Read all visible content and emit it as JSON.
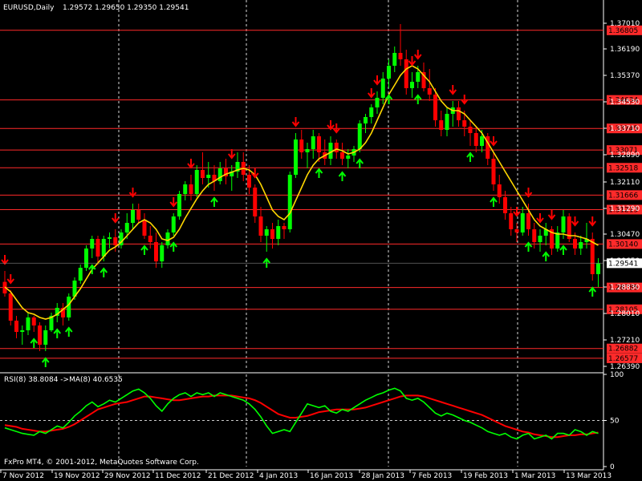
{
  "header": {
    "symbol": "EURUSD,Daily",
    "ohlc": "1.29572 1.29650 1.29350 1.29541"
  },
  "rsi_header": "RSI(8) 38.8084  ->MA(8) 40.6535",
  "footer": "FxPro MT4, © 2001-2012, MetaQuotes Software Corp.",
  "price_axis": {
    "ticks": [
      "1.37010",
      "1.36190",
      "1.35370",
      "1.34530",
      "1.33710",
      "1.32890",
      "1.32110",
      "1.31290",
      "1.30470",
      "1.29650",
      "1.28830",
      "1.28010",
      "1.27210",
      "1.26390"
    ],
    "current": "1.29541",
    "levels": [
      "1.36805",
      "1.34634",
      "1.33745",
      "1.33071",
      "1.32518",
      "1.31666",
      "1.31213",
      "1.30140",
      "1.28785",
      "1.28105",
      "1.26882",
      "1.26577"
    ]
  },
  "rsi_axis": {
    "ticks": [
      "100",
      "50",
      "0"
    ]
  },
  "date_labels": [
    "7 Nov 2012",
    "19 Nov 2012",
    "29 Nov 2012",
    "11 Dec 2012",
    "21 Dec 2012",
    "4 Jan 2013",
    "16 Jan 2013",
    "28 Jan 2013",
    "7 Feb 2013",
    "19 Feb 2013",
    "1 Mar 2013",
    "13 Mar 2013"
  ],
  "colors": {
    "bull": "#00ff00",
    "bear": "#ff0000",
    "ma": "#ffd700",
    "level": "#ff2a2a",
    "rsi": "#00ff00",
    "rsi_ma": "#ff0000",
    "grid": "#ffffff"
  },
  "chart_data": {
    "type": "candlestick",
    "candles": [
      [
        1.2896,
        1.293,
        1.285,
        1.286
      ],
      [
        1.286,
        1.287,
        1.276,
        1.2775
      ],
      [
        1.2775,
        1.279,
        1.272,
        1.274
      ],
      [
        1.274,
        1.276,
        1.27,
        1.2745
      ],
      [
        1.2745,
        1.28,
        1.273,
        1.2785
      ],
      [
        1.2785,
        1.279,
        1.274,
        1.276
      ],
      [
        1.276,
        1.277,
        1.268,
        1.27
      ],
      [
        1.27,
        1.276,
        1.268,
        1.2745
      ],
      [
        1.2745,
        1.28,
        1.274,
        1.279
      ],
      [
        1.279,
        1.283,
        1.277,
        1.2815
      ],
      [
        1.2815,
        1.283,
        1.276,
        1.2785
      ],
      [
        1.2785,
        1.286,
        1.2775,
        1.285
      ],
      [
        1.285,
        1.291,
        1.284,
        1.29
      ],
      [
        1.29,
        1.295,
        1.289,
        1.294
      ],
      [
        1.294,
        1.301,
        1.293,
        1.3
      ],
      [
        1.3,
        1.304,
        1.297,
        1.303
      ],
      [
        1.303,
        1.304,
        1.295,
        1.2975
      ],
      [
        1.2975,
        1.304,
        1.296,
        1.303
      ],
      [
        1.303,
        1.305,
        1.3,
        1.3035
      ],
      [
        1.3035,
        1.306,
        1.299,
        1.301
      ],
      [
        1.301,
        1.306,
        1.3,
        1.305
      ],
      [
        1.305,
        1.311,
        1.303,
        1.308
      ],
      [
        1.308,
        1.314,
        1.306,
        1.312
      ],
      [
        1.312,
        1.314,
        1.308,
        1.309
      ],
      [
        1.309,
        1.311,
        1.303,
        1.304
      ],
      [
        1.304,
        1.307,
        1.3,
        1.302
      ],
      [
        1.302,
        1.305,
        1.294,
        1.296
      ],
      [
        1.296,
        1.302,
        1.294,
        1.301
      ],
      [
        1.301,
        1.306,
        1.3,
        1.305
      ],
      [
        1.305,
        1.311,
        1.304,
        1.31
      ],
      [
        1.31,
        1.318,
        1.309,
        1.317
      ],
      [
        1.317,
        1.321,
        1.315,
        1.32
      ],
      [
        1.32,
        1.323,
        1.315,
        1.317
      ],
      [
        1.317,
        1.326,
        1.316,
        1.3245
      ],
      [
        1.3245,
        1.33,
        1.32,
        1.322
      ],
      [
        1.322,
        1.327,
        1.319,
        1.323
      ],
      [
        1.323,
        1.326,
        1.318,
        1.321
      ],
      [
        1.321,
        1.327,
        1.32,
        1.325
      ],
      [
        1.325,
        1.328,
        1.32,
        1.3225
      ],
      [
        1.3225,
        1.326,
        1.318,
        1.324
      ],
      [
        1.324,
        1.33,
        1.322,
        1.327
      ],
      [
        1.327,
        1.33,
        1.321,
        1.323
      ],
      [
        1.323,
        1.326,
        1.317,
        1.319
      ],
      [
        1.319,
        1.32,
        1.308,
        1.31
      ],
      [
        1.31,
        1.313,
        1.302,
        1.304
      ],
      [
        1.304,
        1.307,
        1.299,
        1.306
      ],
      [
        1.306,
        1.308,
        1.3,
        1.303
      ],
      [
        1.303,
        1.309,
        1.301,
        1.307
      ],
      [
        1.307,
        1.308,
        1.303,
        1.306
      ],
      [
        1.306,
        1.324,
        1.305,
        1.323
      ],
      [
        1.323,
        1.336,
        1.322,
        1.334
      ],
      [
        1.334,
        1.337,
        1.328,
        1.33
      ],
      [
        1.33,
        1.333,
        1.325,
        1.331
      ],
      [
        1.331,
        1.337,
        1.328,
        1.335
      ],
      [
        1.335,
        1.336,
        1.327,
        1.33
      ],
      [
        1.33,
        1.334,
        1.326,
        1.328
      ],
      [
        1.328,
        1.335,
        1.326,
        1.333
      ],
      [
        1.333,
        1.334,
        1.328,
        1.33
      ],
      [
        1.33,
        1.333,
        1.326,
        1.328
      ],
      [
        1.328,
        1.331,
        1.325,
        1.329
      ],
      [
        1.329,
        1.332,
        1.327,
        1.331
      ],
      [
        1.331,
        1.34,
        1.33,
        1.339
      ],
      [
        1.339,
        1.342,
        1.336,
        1.341
      ],
      [
        1.341,
        1.345,
        1.339,
        1.344
      ],
      [
        1.344,
        1.349,
        1.342,
        1.347
      ],
      [
        1.347,
        1.355,
        1.345,
        1.353
      ],
      [
        1.353,
        1.359,
        1.35,
        1.357
      ],
      [
        1.357,
        1.363,
        1.355,
        1.361
      ],
      [
        1.361,
        1.37,
        1.357,
        1.359
      ],
      [
        1.359,
        1.362,
        1.348,
        1.35
      ],
      [
        1.35,
        1.355,
        1.347,
        1.352
      ],
      [
        1.352,
        1.357,
        1.35,
        1.355
      ],
      [
        1.355,
        1.358,
        1.349,
        1.35
      ],
      [
        1.35,
        1.356,
        1.346,
        1.348
      ],
      [
        1.348,
        1.35,
        1.338,
        1.34
      ],
      [
        1.34,
        1.343,
        1.335,
        1.337
      ],
      [
        1.337,
        1.344,
        1.335,
        1.342
      ],
      [
        1.342,
        1.346,
        1.338,
        1.344
      ],
      [
        1.344,
        1.346,
        1.338,
        1.34
      ],
      [
        1.34,
        1.343,
        1.335,
        1.338
      ],
      [
        1.338,
        1.34,
        1.332,
        1.336
      ],
      [
        1.336,
        1.338,
        1.33,
        1.332
      ],
      [
        1.332,
        1.337,
        1.33,
        1.335
      ],
      [
        1.335,
        1.336,
        1.326,
        1.328
      ],
      [
        1.328,
        1.33,
        1.318,
        1.32
      ],
      [
        1.32,
        1.323,
        1.314,
        1.316
      ],
      [
        1.316,
        1.318,
        1.309,
        1.311
      ],
      [
        1.311,
        1.313,
        1.304,
        1.306
      ],
      [
        1.306,
        1.308,
        1.302,
        1.305
      ],
      [
        1.305,
        1.313,
        1.304,
        1.311
      ],
      [
        1.311,
        1.314,
        1.304,
        1.306
      ],
      [
        1.306,
        1.308,
        1.3,
        1.302
      ],
      [
        1.302,
        1.306,
        1.299,
        1.304
      ],
      [
        1.304,
        1.308,
        1.301,
        1.306
      ],
      [
        1.306,
        1.307,
        1.298,
        1.3
      ],
      [
        1.3,
        1.307,
        1.299,
        1.305
      ],
      [
        1.305,
        1.312,
        1.303,
        1.31
      ],
      [
        1.31,
        1.311,
        1.302,
        1.303
      ],
      [
        1.303,
        1.305,
        1.298,
        1.3
      ],
      [
        1.3,
        1.304,
        1.298,
        1.302
      ],
      [
        1.302,
        1.308,
        1.3,
        1.303
      ],
      [
        1.303,
        1.305,
        1.29,
        1.292
      ],
      [
        1.292,
        1.297,
        1.288,
        1.2954
      ]
    ],
    "ma": [
      1.288,
      1.2865,
      1.284,
      1.2815,
      1.28,
      1.2795,
      1.2785,
      1.278,
      1.2785,
      1.2795,
      1.281,
      1.2825,
      1.285,
      1.2875,
      1.2905,
      1.2935,
      1.2955,
      1.2975,
      1.2995,
      1.3005,
      1.302,
      1.304,
      1.306,
      1.308,
      1.309,
      1.308,
      1.306,
      1.303,
      1.3025,
      1.3035,
      1.306,
      1.3095,
      1.3125,
      1.3155,
      1.318,
      1.32,
      1.321,
      1.3222,
      1.3232,
      1.3238,
      1.3245,
      1.325,
      1.3245,
      1.323,
      1.32,
      1.316,
      1.312,
      1.31,
      1.309,
      1.311,
      1.315,
      1.319,
      1.323,
      1.326,
      1.328,
      1.329,
      1.33,
      1.331,
      1.3305,
      1.3295,
      1.33,
      1.331,
      1.333,
      1.336,
      1.34,
      1.344,
      1.348,
      1.351,
      1.354,
      1.356,
      1.357,
      1.356,
      1.354,
      1.352,
      1.349,
      1.346,
      1.344,
      1.343,
      1.343,
      1.342,
      1.34,
      1.338,
      1.336,
      1.333,
      1.33,
      1.327,
      1.324,
      1.321,
      1.318,
      1.315,
      1.312,
      1.309,
      1.307,
      1.306,
      1.305,
      1.3045,
      1.3045,
      1.304,
      1.304,
      1.3035,
      1.303,
      1.302,
      1.301
    ],
    "sell_signals": [
      0,
      1,
      19,
      22,
      29,
      32,
      39,
      43,
      50,
      56,
      57,
      63,
      64,
      70,
      71,
      77,
      79,
      84,
      88,
      90,
      92,
      94,
      98,
      101
    ],
    "buy_signals": [
      5,
      7,
      9,
      11,
      15,
      17,
      24,
      29,
      36,
      45,
      54,
      58,
      61,
      66,
      71,
      80,
      84,
      90,
      93,
      96,
      101
    ],
    "rsi": [
      42,
      40,
      38,
      36,
      35,
      34,
      38,
      36,
      40,
      44,
      42,
      48,
      55,
      60,
      66,
      70,
      65,
      68,
      72,
      70,
      74,
      78,
      82,
      84,
      80,
      74,
      66,
      60,
      68,
      74,
      78,
      80,
      76,
      80,
      78,
      80,
      76,
      80,
      78,
      76,
      74,
      72,
      68,
      62,
      54,
      44,
      36,
      38,
      40,
      38,
      48,
      58,
      68,
      66,
      64,
      66,
      60,
      58,
      62,
      60,
      64,
      68,
      72,
      75,
      78,
      80,
      83,
      85,
      82,
      74,
      72,
      74,
      70,
      64,
      58,
      55,
      58,
      56,
      53,
      50,
      48,
      45,
      42,
      38,
      36,
      34,
      36,
      32,
      30,
      34,
      36,
      30,
      32,
      34,
      30,
      36,
      36,
      34,
      40,
      38,
      34,
      38,
      36
    ],
    "rsi_ma": [
      45,
      44,
      43,
      41,
      40,
      39,
      38,
      38,
      39,
      40,
      41,
      43,
      46,
      50,
      54,
      58,
      62,
      64,
      66,
      68,
      69,
      70,
      72,
      74,
      76,
      76,
      75,
      74,
      73,
      72,
      72,
      73,
      74,
      75,
      76,
      76,
      77,
      77,
      77,
      77,
      76,
      75,
      74,
      72,
      69,
      65,
      61,
      57,
      55,
      53,
      53,
      54,
      55,
      57,
      59,
      60,
      61,
      62,
      62,
      62,
      62,
      63,
      64,
      66,
      68,
      70,
      72,
      74,
      76,
      77,
      77,
      77,
      76,
      74,
      72,
      70,
      68,
      66,
      64,
      62,
      60,
      58,
      56,
      53,
      50,
      47,
      44,
      42,
      40,
      38,
      37,
      35,
      34,
      33,
      32,
      32,
      33,
      34,
      34,
      35,
      35,
      36,
      37
    ]
  }
}
